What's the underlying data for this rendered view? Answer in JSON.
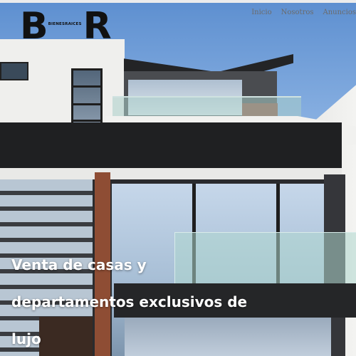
{
  "brand": {
    "logo_letter_1": "B",
    "logo_letter_2": "R",
    "tagline": "BIENESRAICES"
  },
  "nav": {
    "items": [
      "Inicio",
      "Nosotros",
      "Anuncios"
    ]
  },
  "hero": {
    "line1": "Venta de casas y",
    "line2": "departamentos exclusivos de",
    "line3": "lujo"
  },
  "colors": {
    "nav_text": "#6b6b6b",
    "hero_text": "#ffffff",
    "logo": "#111111"
  }
}
